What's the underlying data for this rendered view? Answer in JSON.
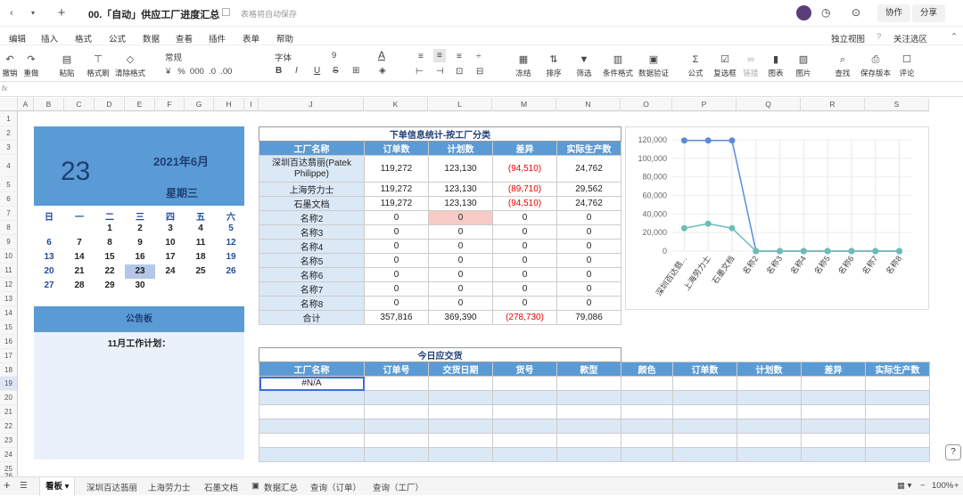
{
  "titlebar": {
    "doc_title": "00.「自动」供应工厂进度汇总",
    "autosave": "表格将自动保存",
    "collab": "协作",
    "share": "分享"
  },
  "menu": [
    "编辑",
    "插入",
    "格式",
    "公式",
    "数据",
    "查看",
    "插件",
    "表单",
    "帮助"
  ],
  "menu_right": {
    "view": "独立视图",
    "follow": "关注选区"
  },
  "toolbar": {
    "undo": "撤销",
    "redo": "重做",
    "paste": "粘贴",
    "format_painter": "格式刷",
    "clear_format": "清除格式",
    "number_format": "常规",
    "font": "字体",
    "font_size": "9",
    "freeze": "冻结",
    "sort": "排序",
    "filter": "筛选",
    "cond_format": "条件格式",
    "data_validation": "数据验证",
    "formula": "公式",
    "checkbox": "复选框",
    "link": "链接",
    "chart": "图表",
    "image": "图片",
    "find": "查找",
    "save_version": "保存版本",
    "comment": "评论"
  },
  "columns": [
    "A",
    "B",
    "C",
    "D",
    "E",
    "F",
    "G",
    "H",
    "I",
    "J",
    "K",
    "L",
    "M",
    "N",
    "O",
    "P",
    "Q",
    "R",
    "S"
  ],
  "rows": [
    "1",
    "2",
    "3",
    "4",
    "5",
    "6",
    "7",
    "8",
    "9",
    "10",
    "11",
    "12",
    "13",
    "14",
    "15",
    "16",
    "17",
    "18",
    "19",
    "20",
    "21",
    "22",
    "23",
    "24",
    "25",
    "26"
  ],
  "calendar": {
    "day": "23",
    "month": "2021年6月",
    "weekday": "星期三",
    "weekdays": [
      "日",
      "一",
      "二",
      "三",
      "四",
      "五",
      "六"
    ],
    "weeks": [
      [
        "",
        "",
        "1",
        "2",
        "3",
        "4",
        "5"
      ],
      [
        "6",
        "7",
        "8",
        "9",
        "10",
        "11",
        "12"
      ],
      [
        "13",
        "14",
        "15",
        "16",
        "17",
        "18",
        "19"
      ],
      [
        "20",
        "21",
        "22",
        "23",
        "24",
        "25",
        "26"
      ],
      [
        "27",
        "28",
        "29",
        "30",
        "",
        "",
        ""
      ]
    ]
  },
  "notice": {
    "title": "公告板",
    "body": "11月工作计划："
  },
  "order_table": {
    "caption": "下单信息统计-按工厂分类",
    "headers": [
      "工厂名称",
      "订单数",
      "计划数",
      "差异",
      "实际生产数"
    ],
    "rows": [
      [
        "深圳百达翡丽(Patek Philippe)",
        "119,272",
        "123,130",
        "(94,510)",
        "24,762"
      ],
      [
        "上海劳力士",
        "119,272",
        "123,130",
        "(89,710)",
        "29,562"
      ],
      [
        "石墨文档",
        "119,272",
        "123,130",
        "(94,510)",
        "24,762"
      ],
      [
        "名称2",
        "0",
        "0",
        "0",
        "0"
      ],
      [
        "名称3",
        "0",
        "0",
        "0",
        "0"
      ],
      [
        "名称4",
        "0",
        "0",
        "0",
        "0"
      ],
      [
        "名称5",
        "0",
        "0",
        "0",
        "0"
      ],
      [
        "名称6",
        "0",
        "0",
        "0",
        "0"
      ],
      [
        "名称7",
        "0",
        "0",
        "0",
        "0"
      ],
      [
        "名称8",
        "0",
        "0",
        "0",
        "0"
      ],
      [
        "合计",
        "357,816",
        "369,390",
        "(278,730)",
        "79,086"
      ]
    ]
  },
  "delivery_table": {
    "caption": "今日应交货",
    "headers": [
      "工厂名称",
      "订单号",
      "交货日期",
      "货号",
      "款型",
      "颜色",
      "订单数",
      "计划数",
      "差异",
      "实际生产数"
    ],
    "first_cell": "#N/A"
  },
  "chart_data": {
    "type": "line",
    "categories": [
      "深圳百达翡...",
      "上海劳力士",
      "石墨文档",
      "名称2",
      "名称3",
      "名称4",
      "名称5",
      "名称6",
      "名称7",
      "名称8"
    ],
    "series": [
      {
        "values": [
          119272,
          119272,
          119272,
          0,
          0,
          0,
          0,
          0,
          0,
          0
        ],
        "color": "#5b8bd6"
      },
      {
        "values": [
          24762,
          29562,
          24762,
          0,
          0,
          0,
          0,
          0,
          0,
          0
        ],
        "color": "#6cbcb8"
      }
    ],
    "yticks": [
      "0",
      "20,000",
      "40,000",
      "60,000",
      "80,000",
      "100,000",
      "120,000"
    ],
    "ylim": [
      0,
      120000
    ],
    "grid": true
  },
  "sheets": [
    "看板",
    "深圳百达翡丽",
    "上海劳力士",
    "石墨文档",
    "数据汇总",
    "查询（订单）",
    "查询（工厂）"
  ],
  "zoom": "100%"
}
